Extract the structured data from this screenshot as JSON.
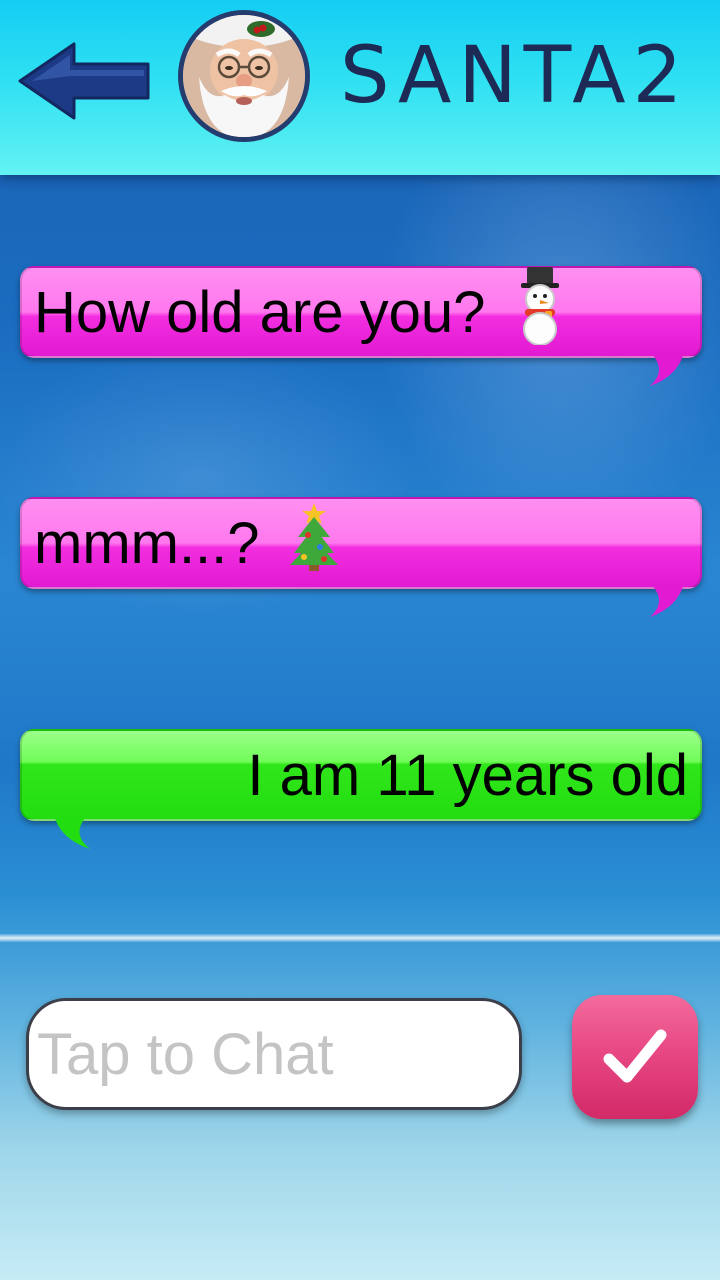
{
  "header": {
    "title": "SANTA2",
    "back_icon": "back-arrow-icon",
    "avatar": "santa-avatar"
  },
  "colors": {
    "header_top": "#14cdf3",
    "header_bottom": "#63f2f2",
    "title": "#1c2a55",
    "incoming_bubble": "#ff5cec",
    "outgoing_bubble": "#33e61f",
    "send_button": "#e84884"
  },
  "messages": [
    {
      "text": "How old are you?",
      "sender": "santa",
      "emoji": "snowman-icon"
    },
    {
      "text": "mmm...?",
      "sender": "santa",
      "emoji": "christmas-tree-icon"
    },
    {
      "text": "I am 11 years old",
      "sender": "user",
      "emoji": ""
    }
  ],
  "composer": {
    "placeholder": "Tap to Chat",
    "value": "",
    "send_icon": "checkmark-icon"
  }
}
